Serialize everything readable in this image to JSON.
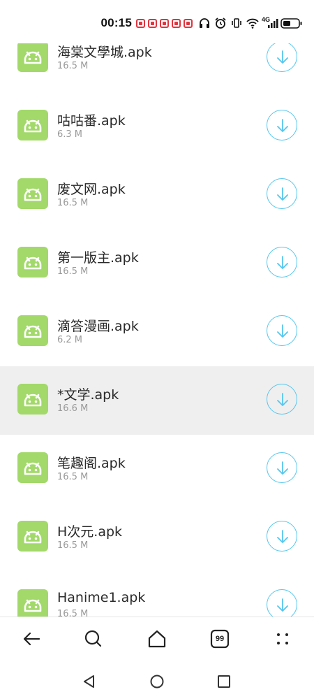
{
  "status_bar": {
    "time": "00:15",
    "network_label": "4G",
    "notification_count": 5,
    "notification_color": "#e0353f"
  },
  "colors": {
    "app_icon_bg": "#a2d96a",
    "download_accent": "#55c7ee",
    "highlight_row_bg": "#efefef",
    "size_text": "#9a9a9a"
  },
  "files": [
    {
      "name": "海棠文學城.apk",
      "size": "16.5 M",
      "icon": "android-icon",
      "action_icon": "download-icon",
      "highlighted": false
    },
    {
      "name": "咕咕番.apk",
      "size": "6.3 M",
      "icon": "android-icon",
      "action_icon": "download-icon",
      "highlighted": false
    },
    {
      "name": "废文网.apk",
      "size": "16.5 M",
      "icon": "android-icon",
      "action_icon": "download-icon",
      "highlighted": false
    },
    {
      "name": "第一版主.apk",
      "size": "16.5 M",
      "icon": "android-icon",
      "action_icon": "download-icon",
      "highlighted": false
    },
    {
      "name": "滴答漫画.apk",
      "size": "6.2 M",
      "icon": "android-icon",
      "action_icon": "download-icon",
      "highlighted": false
    },
    {
      "name": "*文学.apk",
      "size": "16.6 M",
      "icon": "android-icon",
      "action_icon": "download-icon",
      "highlighted": true
    },
    {
      "name": "笔趣阁.apk",
      "size": "16.5 M",
      "icon": "android-icon",
      "action_icon": "download-icon",
      "highlighted": false
    },
    {
      "name": "H次元.apk",
      "size": "16.5 M",
      "icon": "android-icon",
      "action_icon": "download-icon",
      "highlighted": false
    },
    {
      "name": "Hanime1.apk",
      "size": "16.5 M",
      "icon": "android-icon",
      "action_icon": "download-icon",
      "highlighted": false
    }
  ],
  "toolbar": {
    "back_icon": "arrow-left-icon",
    "search_icon": "search-icon",
    "home_icon": "home-icon",
    "tab_count": "99",
    "menu_icon": "more-dots-icon"
  },
  "navbar": {
    "back_icon": "triangle-back-icon",
    "home_icon": "circle-home-icon",
    "recents_icon": "square-recents-icon"
  }
}
